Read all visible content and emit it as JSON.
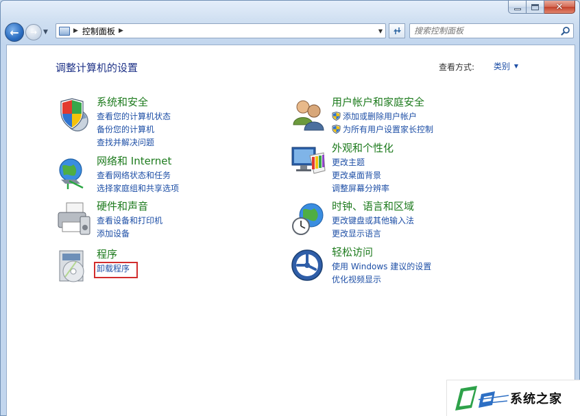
{
  "window": {
    "address": {
      "crumb": "控制面板"
    },
    "search": {
      "placeholder": "搜索控制面板"
    }
  },
  "main": {
    "title": "调整计算机的设置",
    "view_by_label": "查看方式:",
    "view_by_value": "类别"
  },
  "categories": [
    {
      "title": "系统和安全",
      "links": [
        "查看您的计算机状态",
        "备份您的计算机",
        "查找并解决问题"
      ]
    },
    {
      "title": "网络和 Internet",
      "links": [
        "查看网络状态和任务",
        "选择家庭组和共享选项"
      ]
    },
    {
      "title": "硬件和声音",
      "links": [
        "查看设备和打印机",
        "添加设备"
      ]
    },
    {
      "title": "程序",
      "links": [
        "卸载程序"
      ]
    },
    {
      "title": "用户帐户和家庭安全",
      "links": [
        "添加或删除用户帐户",
        "为所有用户设置家长控制"
      ]
    },
    {
      "title": "外观和个性化",
      "links": [
        "更改主题",
        "更改桌面背景",
        "调整屏幕分辨率"
      ]
    },
    {
      "title": "时钟、语言和区域",
      "links": [
        "更改键盘或其他输入法",
        "更改显示语言"
      ]
    },
    {
      "title": "轻松访问",
      "links": [
        "使用 Windows 建议的设置",
        "优化视频显示"
      ]
    }
  ],
  "watermark": {
    "text": "系统之家"
  },
  "colors": {
    "category_title": "#1c7a1c",
    "link": "#1e4fa6",
    "page_title": "#1e3287",
    "highlight_box": "#d12c2c"
  }
}
